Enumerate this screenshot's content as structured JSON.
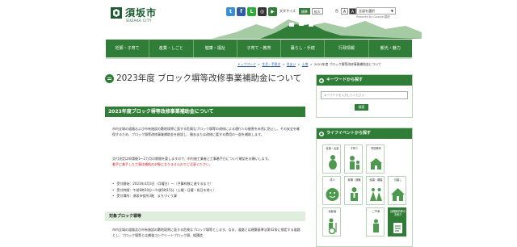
{
  "header": {
    "logo_name": "須坂市",
    "logo_sub": "SUZAKA CITY",
    "social": [
      {
        "icon": "twitter-icon",
        "glyph": "t",
        "color": "#3b8ed2"
      },
      {
        "icon": "facebook-icon",
        "glyph": "f",
        "color": "#2f5ba7"
      },
      {
        "icon": "line-icon",
        "glyph": "L",
        "color": "#2faa3a"
      },
      {
        "icon": "instagram-icon",
        "glyph": "◎",
        "color": "#333333"
      },
      {
        "icon": "youtube-icon",
        "glyph": "▶",
        "color": "#2f7d36"
      }
    ],
    "font_size_label": "文字サイズ",
    "font_size_buttons": [
      "標準",
      "拡大"
    ],
    "color_label": "色",
    "colors": [
      {
        "glyph": "A",
        "bg": "#ffffff",
        "fg": "#333333"
      },
      {
        "glyph": "A",
        "bg": "#333333",
        "fg": "#ffffff"
      },
      {
        "glyph": "A",
        "bg": "#2456a8",
        "fg": "#ffffff"
      }
    ],
    "language_select": "言語を選択",
    "powered_by": "Powered by Google 翻訳"
  },
  "nav": [
    "妊娠・子育て",
    "産業・しごと",
    "健康・福祉",
    "子育て・教育",
    "暮らし・手続",
    "行政情報",
    "観光・魅力"
  ],
  "breadcrumb": {
    "items": [
      "トップページ",
      "生活・手続き",
      "住まい",
      "土地",
      "2023年度 ブロック塀等改修事業補助金について"
    ],
    "separator": ">"
  },
  "main": {
    "title": "2023年度 ブロック塀等改修事業補助金について",
    "section_heading": "2023年度ブロック塀等改修事業補助金について",
    "para1": "市内全域の道路および市有施設の敷地境界に面する危険なブロック塀等の改修による通行人の被害を未然に防止し、その安全を確保するため、ブロック塀等改修事業補助金を創設し、撤去または改修に要する費用の一部を補助します。",
    "para2_normal": "交付決定は申請後1～2カ月の期間を要しますので、市内施工業者と工事着手日について確認をお願いします。",
    "para2_red": "着手に着手した工事は補助の対象になりませんのでご注意ください。",
    "list": [
      "受付開始：2023年4月3日（月曜日）～（予算枠数に達するまで）",
      "受付時間：午前8時30分～午後5時15分（土曜・日曜・祝日を除く）",
      "受付場所：須坂市役所3階　まちづくり課"
    ],
    "sub_heading": "対象ブロック塀等",
    "para3": "市内全域の道路及び市有施設の敷地境界に面する危険なブロック塀等とします。なお、道路とは建築基準法第42条に規定する道路とし、ブロック塀等とは補強コンクリートブロック塀、組積造"
  },
  "sidebar": {
    "search_heading": "キーワードから探す",
    "search_placeholder": "キーワードを入力してください",
    "search_button": "検索",
    "life_heading": "ライフイベントから探す",
    "life_events": [
      {
        "label": "妊娠・出産",
        "icon": "pregnancy-icon"
      },
      {
        "label": "子育て",
        "icon": "parenting-icon"
      },
      {
        "label": "学校教育",
        "icon": "school-icon"
      },
      {
        "label": "",
        "icon": "blank-icon"
      },
      {
        "label": "成人",
        "icon": "adult-icon"
      },
      {
        "label": "就職・退職",
        "icon": "job-icon"
      },
      {
        "label": "結婚・離婚",
        "icon": "marriage-icon"
      },
      {
        "label": "引越し",
        "icon": "moving-icon"
      },
      {
        "label": "高齢者",
        "icon": "elderly-icon"
      },
      {
        "label": "",
        "icon": "blank-icon"
      },
      {
        "label": "ご不幸",
        "icon": "bereavement-icon"
      },
      {
        "label": "請願陳情等の手続き",
        "icon": "document-icon"
      }
    ]
  },
  "colors": {
    "primary_green": "#2f7d36",
    "light_green": "#dfeedd",
    "link_blue": "#2456a8",
    "alert_red": "#cc1e1e"
  }
}
